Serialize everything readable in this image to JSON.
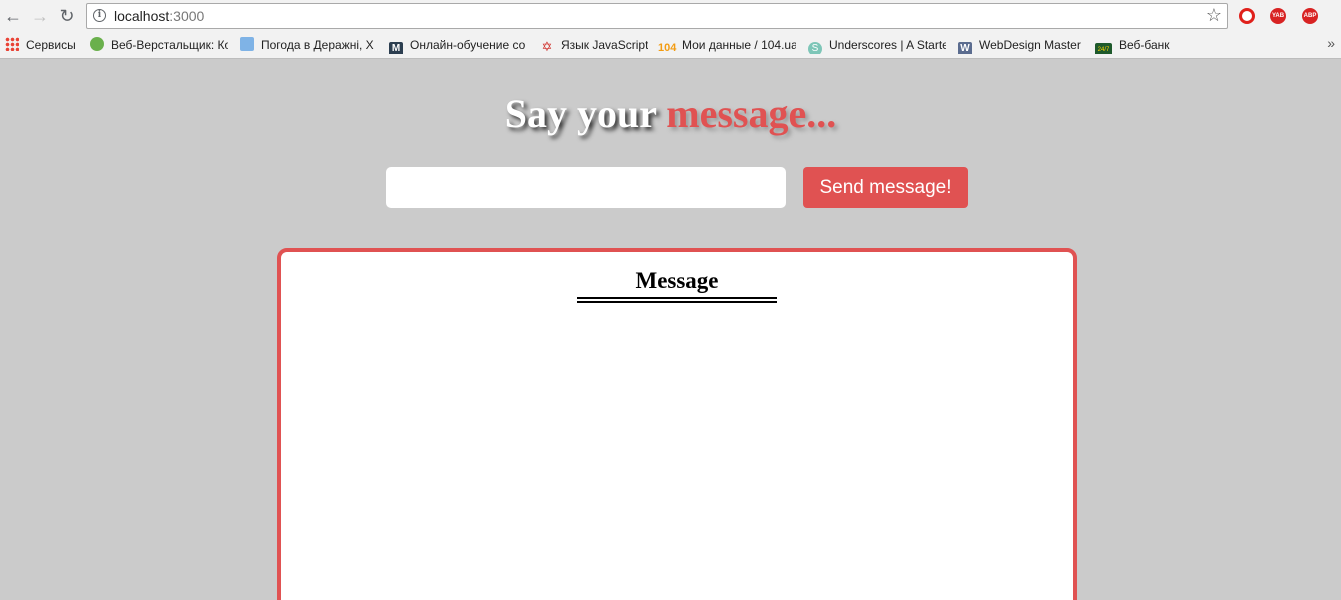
{
  "browser": {
    "url_host": "localhost",
    "url_port": ":3000",
    "bookmarks": [
      "Сервисы",
      "Веб-Верстальщик: Ко",
      "Погода в Деражні, Х",
      "Онлайн-обучение со",
      "Язык JavaScript",
      "Мои данные / 104.ua",
      "Underscores | A Starte",
      "WebDesign Master",
      "Веб-банк"
    ],
    "bookmark_icon_labels": {
      "104": "104",
      "webbank": "24/7",
      "webdesign": "W",
      "online": "M",
      "underscores": "S"
    },
    "extensions": [
      "YAB",
      "ABP"
    ]
  },
  "page": {
    "headline_part1": "Say your",
    "headline_part2": "message...",
    "input_value": "",
    "send_button": "Send message!",
    "panel_title": "Message"
  },
  "colors": {
    "accent": "#e05252",
    "background": "#cbcbcb"
  }
}
